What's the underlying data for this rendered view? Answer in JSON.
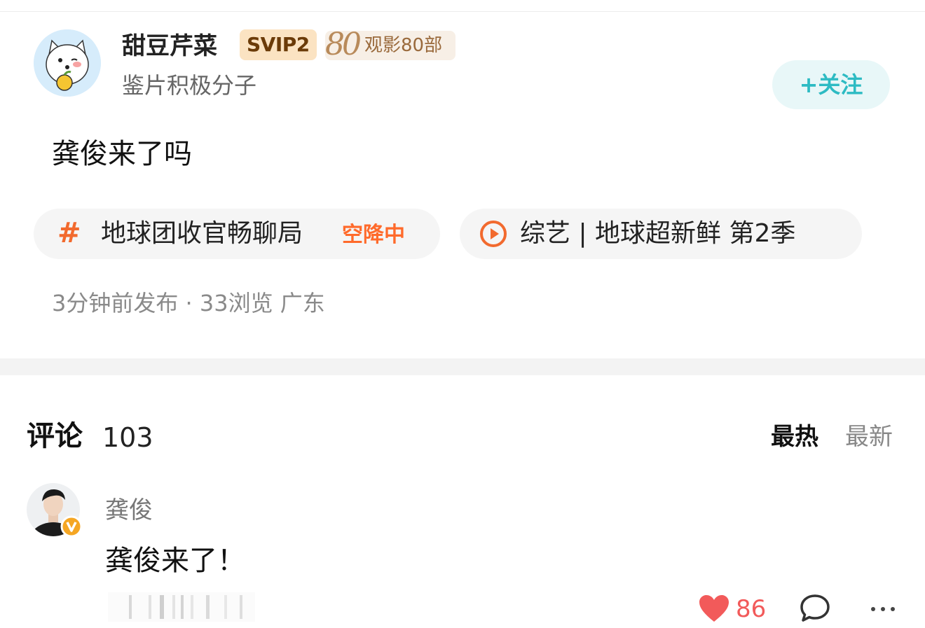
{
  "post": {
    "author": {
      "name": "甜豆芹菜",
      "svip_badge": "SVIP2",
      "watch_count_display": "80",
      "watch_label": "观影80部",
      "title": "鉴片积极分子"
    },
    "follow_label": "+关注",
    "text": "龚俊来了吗",
    "tags": [
      {
        "label": "地球团收官畅聊局",
        "badge": "空降中",
        "icon": "hash-icon"
      },
      {
        "label": "综艺 | 地球超新鲜 第2季",
        "icon": "play-icon"
      }
    ],
    "meta": "3分钟前发布 · 33浏览 广东"
  },
  "comments": {
    "title": "评论",
    "count": "103",
    "sort_hot": "最热",
    "sort_new": "最新",
    "items": [
      {
        "author": "龚俊",
        "verified": true,
        "text": "龚俊来了！",
        "likes": "86"
      }
    ]
  },
  "colors": {
    "accent_teal": "#2dbbc3",
    "topic_orange": "#f26a2e",
    "like_red": "#f25a5a",
    "svip_bg": "#fbe3c2"
  }
}
